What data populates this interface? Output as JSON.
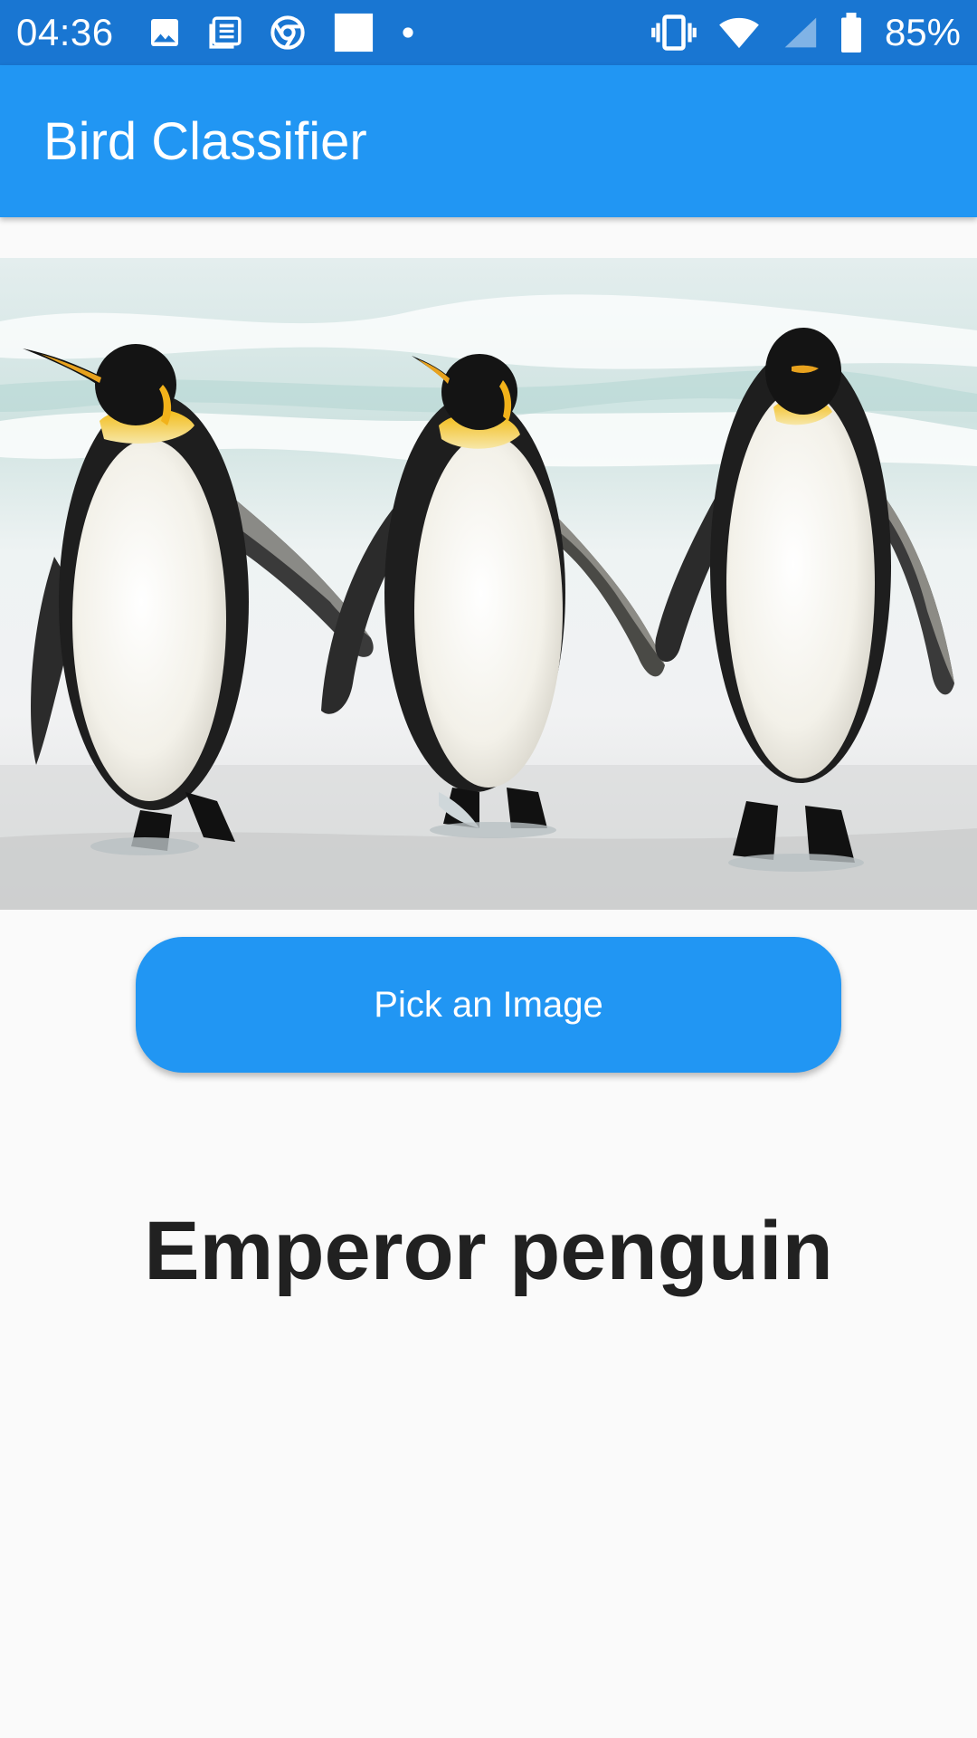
{
  "status_bar": {
    "time": "04:36",
    "battery_percent": "85%",
    "icons_left": [
      "gallery-icon",
      "news-icon",
      "chrome-icon",
      "blank-notification-icon",
      "dot-icon"
    ],
    "icons_right": [
      "vibrate-icon",
      "wifi-icon",
      "signal-icon",
      "battery-icon"
    ],
    "color": "#1976D2"
  },
  "app_bar": {
    "title": "Bird Classifier",
    "color": "#2196F3"
  },
  "photo": {
    "subject": "three-penguins-on-beach"
  },
  "button": {
    "label": "Pick an Image",
    "color": "#2196F3"
  },
  "result": {
    "label": "Emperor penguin"
  }
}
